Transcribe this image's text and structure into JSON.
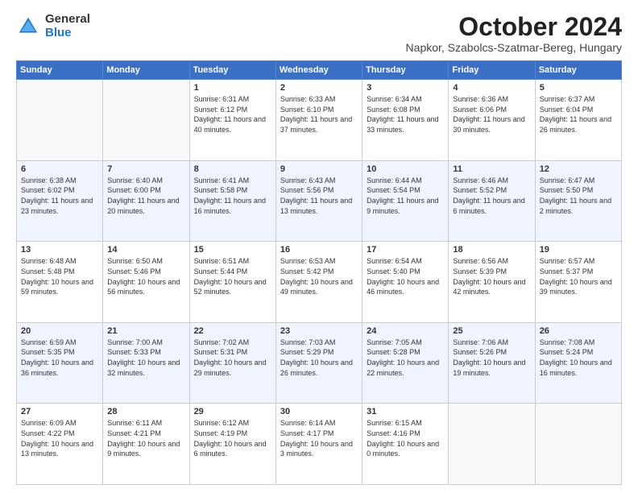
{
  "header": {
    "logo_general": "General",
    "logo_blue": "Blue",
    "title": "October 2024",
    "location": "Napkor, Szabolcs-Szatmar-Bereg, Hungary"
  },
  "weekdays": [
    "Sunday",
    "Monday",
    "Tuesday",
    "Wednesday",
    "Thursday",
    "Friday",
    "Saturday"
  ],
  "weeks": [
    [
      {
        "day": "",
        "info": ""
      },
      {
        "day": "",
        "info": ""
      },
      {
        "day": "1",
        "info": "Sunrise: 6:31 AM\nSunset: 6:12 PM\nDaylight: 11 hours and 40 minutes."
      },
      {
        "day": "2",
        "info": "Sunrise: 6:33 AM\nSunset: 6:10 PM\nDaylight: 11 hours and 37 minutes."
      },
      {
        "day": "3",
        "info": "Sunrise: 6:34 AM\nSunset: 6:08 PM\nDaylight: 11 hours and 33 minutes."
      },
      {
        "day": "4",
        "info": "Sunrise: 6:36 AM\nSunset: 6:06 PM\nDaylight: 11 hours and 30 minutes."
      },
      {
        "day": "5",
        "info": "Sunrise: 6:37 AM\nSunset: 6:04 PM\nDaylight: 11 hours and 26 minutes."
      }
    ],
    [
      {
        "day": "6",
        "info": "Sunrise: 6:38 AM\nSunset: 6:02 PM\nDaylight: 11 hours and 23 minutes."
      },
      {
        "day": "7",
        "info": "Sunrise: 6:40 AM\nSunset: 6:00 PM\nDaylight: 11 hours and 20 minutes."
      },
      {
        "day": "8",
        "info": "Sunrise: 6:41 AM\nSunset: 5:58 PM\nDaylight: 11 hours and 16 minutes."
      },
      {
        "day": "9",
        "info": "Sunrise: 6:43 AM\nSunset: 5:56 PM\nDaylight: 11 hours and 13 minutes."
      },
      {
        "day": "10",
        "info": "Sunrise: 6:44 AM\nSunset: 5:54 PM\nDaylight: 11 hours and 9 minutes."
      },
      {
        "day": "11",
        "info": "Sunrise: 6:46 AM\nSunset: 5:52 PM\nDaylight: 11 hours and 6 minutes."
      },
      {
        "day": "12",
        "info": "Sunrise: 6:47 AM\nSunset: 5:50 PM\nDaylight: 11 hours and 2 minutes."
      }
    ],
    [
      {
        "day": "13",
        "info": "Sunrise: 6:48 AM\nSunset: 5:48 PM\nDaylight: 10 hours and 59 minutes."
      },
      {
        "day": "14",
        "info": "Sunrise: 6:50 AM\nSunset: 5:46 PM\nDaylight: 10 hours and 56 minutes."
      },
      {
        "day": "15",
        "info": "Sunrise: 6:51 AM\nSunset: 5:44 PM\nDaylight: 10 hours and 52 minutes."
      },
      {
        "day": "16",
        "info": "Sunrise: 6:53 AM\nSunset: 5:42 PM\nDaylight: 10 hours and 49 minutes."
      },
      {
        "day": "17",
        "info": "Sunrise: 6:54 AM\nSunset: 5:40 PM\nDaylight: 10 hours and 46 minutes."
      },
      {
        "day": "18",
        "info": "Sunrise: 6:56 AM\nSunset: 5:39 PM\nDaylight: 10 hours and 42 minutes."
      },
      {
        "day": "19",
        "info": "Sunrise: 6:57 AM\nSunset: 5:37 PM\nDaylight: 10 hours and 39 minutes."
      }
    ],
    [
      {
        "day": "20",
        "info": "Sunrise: 6:59 AM\nSunset: 5:35 PM\nDaylight: 10 hours and 36 minutes."
      },
      {
        "day": "21",
        "info": "Sunrise: 7:00 AM\nSunset: 5:33 PM\nDaylight: 10 hours and 32 minutes."
      },
      {
        "day": "22",
        "info": "Sunrise: 7:02 AM\nSunset: 5:31 PM\nDaylight: 10 hours and 29 minutes."
      },
      {
        "day": "23",
        "info": "Sunrise: 7:03 AM\nSunset: 5:29 PM\nDaylight: 10 hours and 26 minutes."
      },
      {
        "day": "24",
        "info": "Sunrise: 7:05 AM\nSunset: 5:28 PM\nDaylight: 10 hours and 22 minutes."
      },
      {
        "day": "25",
        "info": "Sunrise: 7:06 AM\nSunset: 5:26 PM\nDaylight: 10 hours and 19 minutes."
      },
      {
        "day": "26",
        "info": "Sunrise: 7:08 AM\nSunset: 5:24 PM\nDaylight: 10 hours and 16 minutes."
      }
    ],
    [
      {
        "day": "27",
        "info": "Sunrise: 6:09 AM\nSunset: 4:22 PM\nDaylight: 10 hours and 13 minutes."
      },
      {
        "day": "28",
        "info": "Sunrise: 6:11 AM\nSunset: 4:21 PM\nDaylight: 10 hours and 9 minutes."
      },
      {
        "day": "29",
        "info": "Sunrise: 6:12 AM\nSunset: 4:19 PM\nDaylight: 10 hours and 6 minutes."
      },
      {
        "day": "30",
        "info": "Sunrise: 6:14 AM\nSunset: 4:17 PM\nDaylight: 10 hours and 3 minutes."
      },
      {
        "day": "31",
        "info": "Sunrise: 6:15 AM\nSunset: 4:16 PM\nDaylight: 10 hours and 0 minutes."
      },
      {
        "day": "",
        "info": ""
      },
      {
        "day": "",
        "info": ""
      }
    ]
  ]
}
